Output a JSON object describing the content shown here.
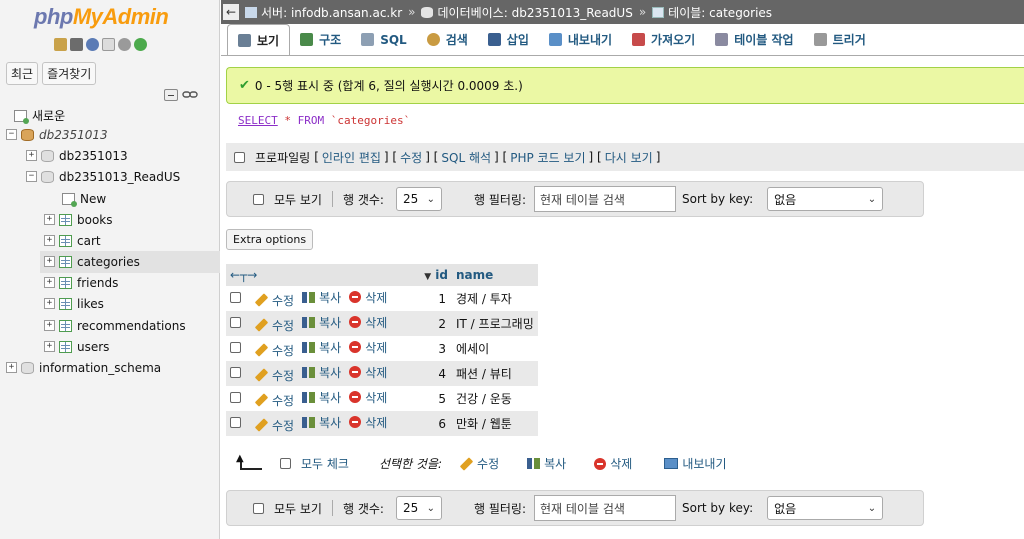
{
  "logo": {
    "part1": "php",
    "part2": "MyAdmin"
  },
  "nav": {
    "tabs": [
      "최근",
      "즐겨찾기"
    ],
    "tree": [
      {
        "label": "새로운",
        "kind": "new",
        "indent": 0
      },
      {
        "label": "db2351013",
        "kind": "db",
        "indent": 0,
        "italic": true
      },
      {
        "label": "db2351013",
        "kind": "db",
        "indent": 1
      },
      {
        "label": "db2351013_ReadUS",
        "kind": "db",
        "indent": 1
      },
      {
        "label": "New",
        "kind": "new",
        "indent": 2
      },
      {
        "label": "books",
        "kind": "table",
        "indent": 2
      },
      {
        "label": "cart",
        "kind": "table",
        "indent": 2
      },
      {
        "label": "categories",
        "kind": "table",
        "indent": 2,
        "active": true
      },
      {
        "label": "friends",
        "kind": "table",
        "indent": 2
      },
      {
        "label": "likes",
        "kind": "table",
        "indent": 2
      },
      {
        "label": "recommendations",
        "kind": "table",
        "indent": 2
      },
      {
        "label": "users",
        "kind": "table",
        "indent": 2
      },
      {
        "label": "information_schema",
        "kind": "db",
        "indent": 0
      }
    ]
  },
  "breadcrumb": {
    "server": "서버: infodb.ansan.ac.kr",
    "database": "데이터베이스: db2351013_ReadUS",
    "table": "테이블: categories",
    "separator": "»"
  },
  "tabs": [
    {
      "label": "보기",
      "active": true,
      "icon": "browse-icon",
      "color": "#6a7f95"
    },
    {
      "label": "구조",
      "icon": "structure-icon",
      "color": "#4a8a4a"
    },
    {
      "label": "SQL",
      "icon": "sql-icon",
      "color": "#8d9fb3"
    },
    {
      "label": "검색",
      "icon": "search-icon",
      "color": "#c99b42"
    },
    {
      "label": "삽입",
      "icon": "insert-icon",
      "color": "#3a5f8f"
    },
    {
      "label": "내보내기",
      "icon": "export-icon",
      "color": "#5a8fc7"
    },
    {
      "label": "가져오기",
      "icon": "import-icon",
      "color": "#c74b4b"
    },
    {
      "label": "테이블 작업",
      "icon": "wrench-icon",
      "color": "#8a8aa0"
    },
    {
      "label": "트리거",
      "icon": "triggers-icon",
      "color": "#999999"
    }
  ],
  "success_message": "0 - 5행 표시 중 (합계 6, 질의 실행시간 0.0009 초.)",
  "sql": {
    "select": "SELECT",
    "star": "*",
    "from": "FROM",
    "table": "`categories`"
  },
  "profiling": {
    "label": "프로파일링",
    "links": [
      "인라인 편집",
      "수정",
      "SQL 해석",
      "PHP 코드 보기",
      "다시 보기"
    ]
  },
  "navbar": {
    "show_all": "모두 보기",
    "rows_label": "행 갯수:",
    "rows_value": "25",
    "filter_label": "행 필터링:",
    "filter_placeholder": "현재 테이블 검색",
    "sort_label": "Sort by key:",
    "sort_value": "없음"
  },
  "extra_options": "Extra options",
  "table": {
    "columns": {
      "id": "id",
      "name": "name"
    },
    "actions": {
      "edit": "수정",
      "copy": "복사",
      "delete": "삭제"
    },
    "rows": [
      {
        "id": "1",
        "name": "경제 / 투자"
      },
      {
        "id": "2",
        "name": "IT / 프로그래밍"
      },
      {
        "id": "3",
        "name": "에세이"
      },
      {
        "id": "4",
        "name": "패션 / 뷰티"
      },
      {
        "id": "5",
        "name": "건강 / 운동"
      },
      {
        "id": "6",
        "name": "만화 / 웹툰"
      }
    ]
  },
  "bulk": {
    "check_all": "모두 체크",
    "with_selected": "선택한 것을:",
    "edit": "수정",
    "copy": "복사",
    "delete": "삭제",
    "export": "내보내기"
  },
  "colors": {
    "accent": "#235a81",
    "success_bg": "#ebf8a4",
    "topbar": "#666666"
  }
}
